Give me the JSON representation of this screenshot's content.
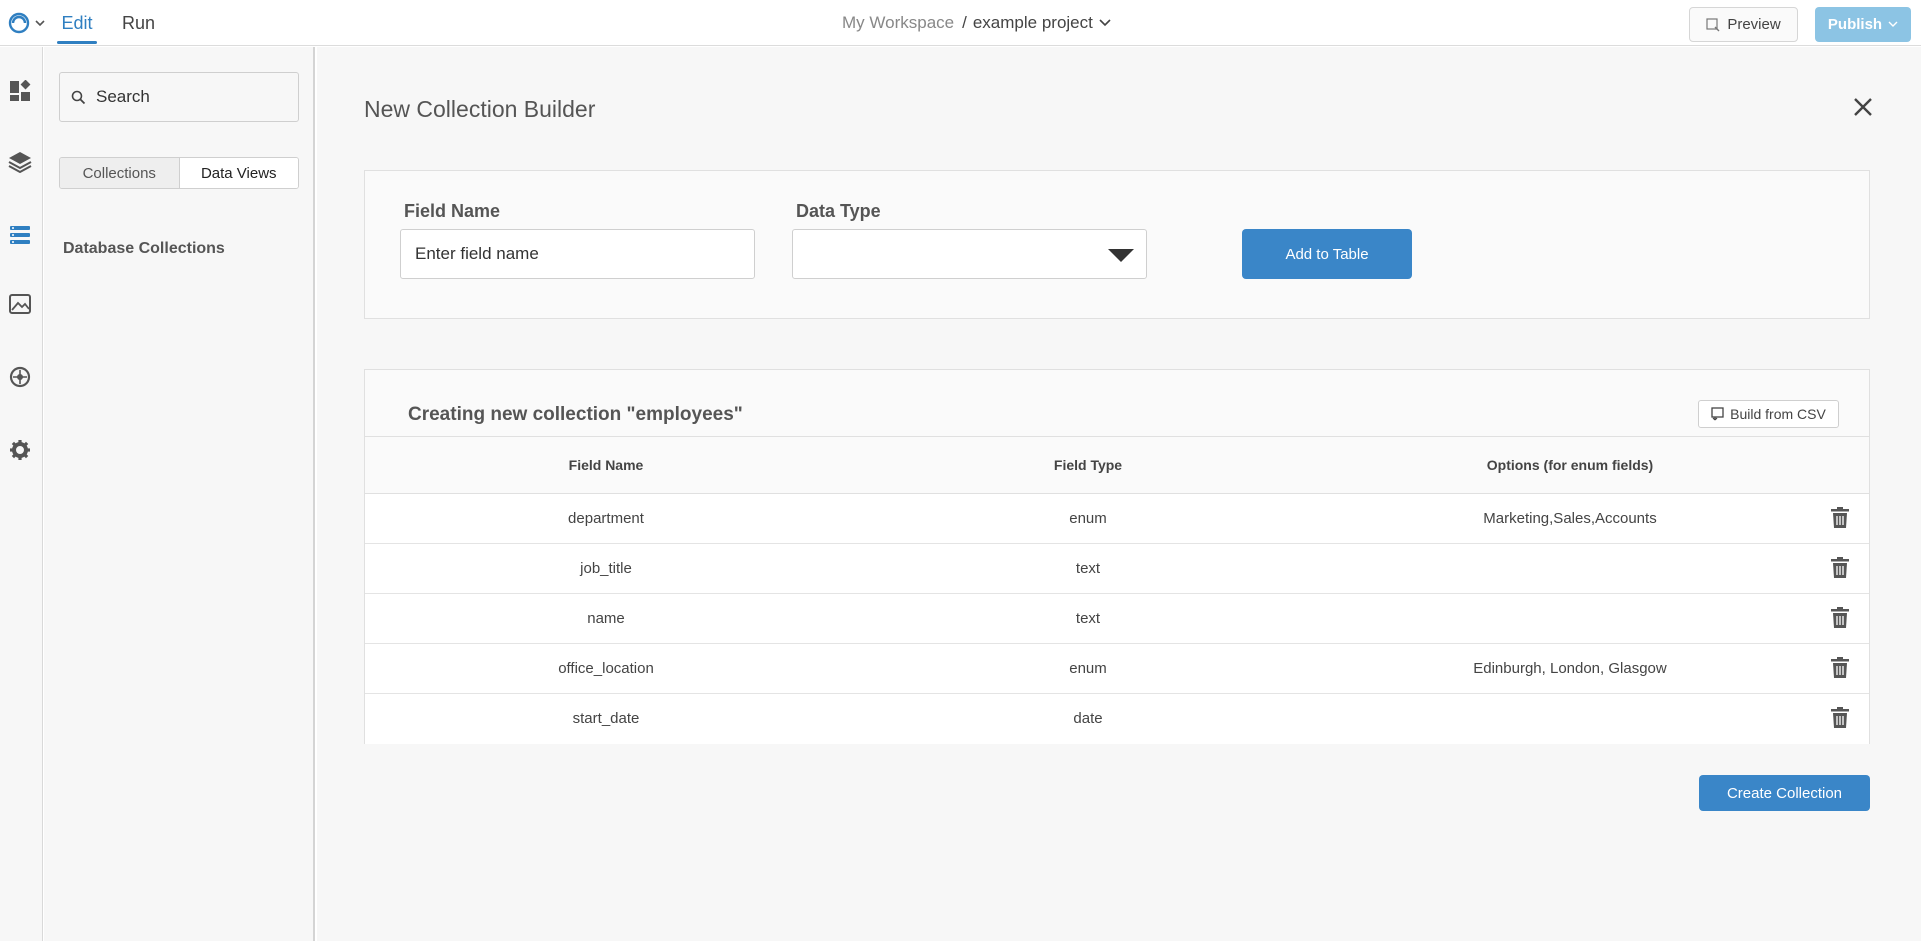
{
  "topbar": {
    "edit_tab": "Edit",
    "run_tab": "Run",
    "workspace": "My Workspace",
    "separator": "/",
    "project": "example project",
    "preview_label": "Preview",
    "publish_label": "Publish"
  },
  "rail": {
    "icons": [
      "dashboard-icon",
      "layers-icon",
      "database-icon",
      "image-icon",
      "api-icon",
      "settings-icon"
    ],
    "active": "database-icon",
    "accent": "#2f7fc1"
  },
  "sidebar": {
    "search_placeholder": "Search",
    "segment_collections": "Collections",
    "segment_data_views": "Data Views",
    "heading": "Database Collections"
  },
  "builder": {
    "title": "New Collection Builder",
    "field_name_label": "Field Name",
    "field_name_placeholder": "Enter field name",
    "data_type_label": "Data Type",
    "data_type_value": "",
    "add_button": "Add to Table",
    "collection_title": "Creating new collection \"employees\"",
    "csv_button": "Build from CSV",
    "columns": [
      "Field Name",
      "Field Type",
      "Options (for enum fields)"
    ],
    "rows": [
      {
        "name": "department",
        "type": "enum",
        "options": "Marketing,Sales,Accounts"
      },
      {
        "name": "job_title",
        "type": "text",
        "options": ""
      },
      {
        "name": "name",
        "type": "text",
        "options": ""
      },
      {
        "name": "office_location",
        "type": "enum",
        "options": "Edinburgh, London, Glasgow"
      },
      {
        "name": "start_date",
        "type": "date",
        "options": ""
      }
    ],
    "create_button": "Create Collection",
    "primary_color": "#3a86c8"
  }
}
